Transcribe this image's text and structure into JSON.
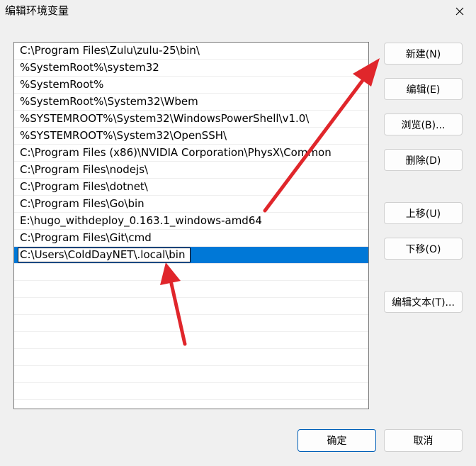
{
  "window": {
    "title": "编辑环境变量"
  },
  "path_list": {
    "items": [
      "C:\\Program Files\\Zulu\\zulu-25\\bin\\",
      "%SystemRoot%\\system32",
      "%SystemRoot%",
      "%SystemRoot%\\System32\\Wbem",
      "%SYSTEMROOT%\\System32\\WindowsPowerShell\\v1.0\\",
      "%SYSTEMROOT%\\System32\\OpenSSH\\",
      "C:\\Program Files (x86)\\NVIDIA Corporation\\PhysX\\Common",
      "C:\\Program Files\\nodejs\\",
      "C:\\Program Files\\dotnet\\",
      "C:\\Program Files\\Go\\bin",
      "E:\\hugo_withdeploy_0.163.1_windows-amd64",
      "C:\\Program Files\\Git\\cmd"
    ],
    "editing_value": "C:\\Users\\ColdDayNET\\.local\\bin"
  },
  "buttons": {
    "new": "新建(N)",
    "edit": "编辑(E)",
    "browse": "浏览(B)...",
    "delete": "删除(D)",
    "move_up": "上移(U)",
    "move_down": "下移(O)",
    "edit_text": "编辑文本(T)...",
    "ok": "确定",
    "cancel": "取消"
  },
  "colors": {
    "selection": "#0078d7",
    "annotation_arrow": "#e0262b"
  }
}
